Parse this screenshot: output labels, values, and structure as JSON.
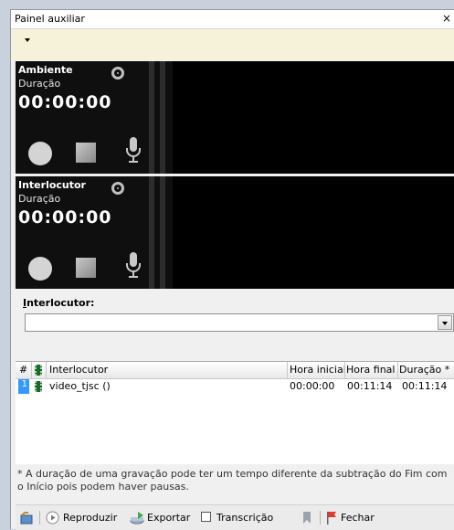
{
  "window": {
    "title": "Painel auxiliar",
    "close_glyph": "×"
  },
  "recorders": [
    {
      "name": "Ambiente",
      "duration_label": "Duração",
      "time": "00:00:00"
    },
    {
      "name": "Interlocutor",
      "duration_label": "Duração",
      "time": "00:00:00"
    }
  ],
  "interlocutor_field": {
    "label_prefix": "I",
    "label_rest": "nterlocutor:",
    "value": ""
  },
  "grid": {
    "columns": [
      "#",
      "Interlocutor",
      "Hora inicial",
      "Hora final",
      "Duração *"
    ],
    "rows": [
      {
        "num": "1",
        "interlocutor": "video_tjsc ()",
        "hora_inicial": "00:00:00",
        "hora_final": "00:11:14",
        "duracao": "00:11:14"
      }
    ]
  },
  "footnote": "* A duração de uma gravação pode ter um tempo diferente da subtração do Fim com o Início pois podem haver pausas.",
  "toolbar": {
    "play_label": "Reproduzir",
    "export_label": "Exportar",
    "transcription_label": "Transcrição",
    "close_label": "Fechar"
  },
  "icons": [
    "close-icon",
    "dropdown-arrow-icon",
    "monitor-icon",
    "record-icon",
    "stop-icon",
    "microphone-icon",
    "film-icon",
    "chevron-down-icon",
    "back-icon",
    "play-icon",
    "export-icon",
    "checkbox-icon",
    "bookmark-icon",
    "flag-icon"
  ],
  "colors": {
    "selection": "#3399ff",
    "dropbar_bg": "#f6f1d9",
    "recorder_bg": "#000000"
  }
}
